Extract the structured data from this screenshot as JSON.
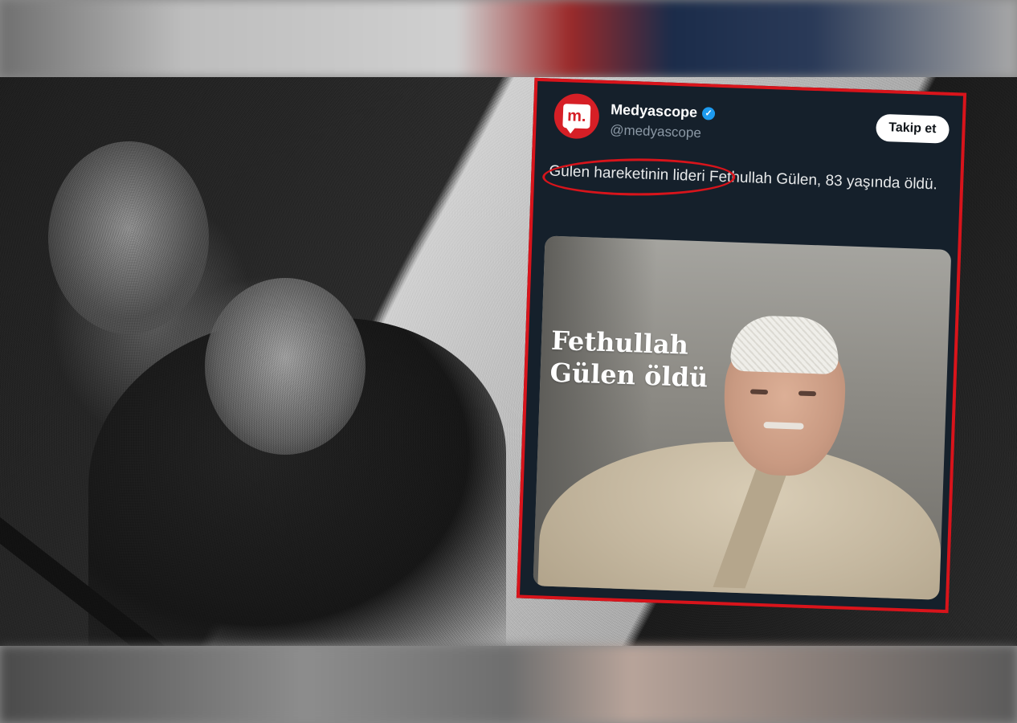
{
  "tweet": {
    "account_name": "Medyascope",
    "handle": "@medyascope",
    "avatar_text": "m.",
    "follow_label": "Takip et",
    "text": "Gülen hareketinin lideri Fethullah Gülen, 83 yaşında öldü.",
    "media_headline_line1": "Fethullah",
    "media_headline_line2": "Gülen öldü"
  },
  "colors": {
    "accent_red": "#d8141b",
    "tweet_bg": "#15202b",
    "verified_blue": "#1d9bf0"
  },
  "icons": {
    "verified": "verified-badge-icon",
    "avatar": "medyascope-logo-icon"
  }
}
